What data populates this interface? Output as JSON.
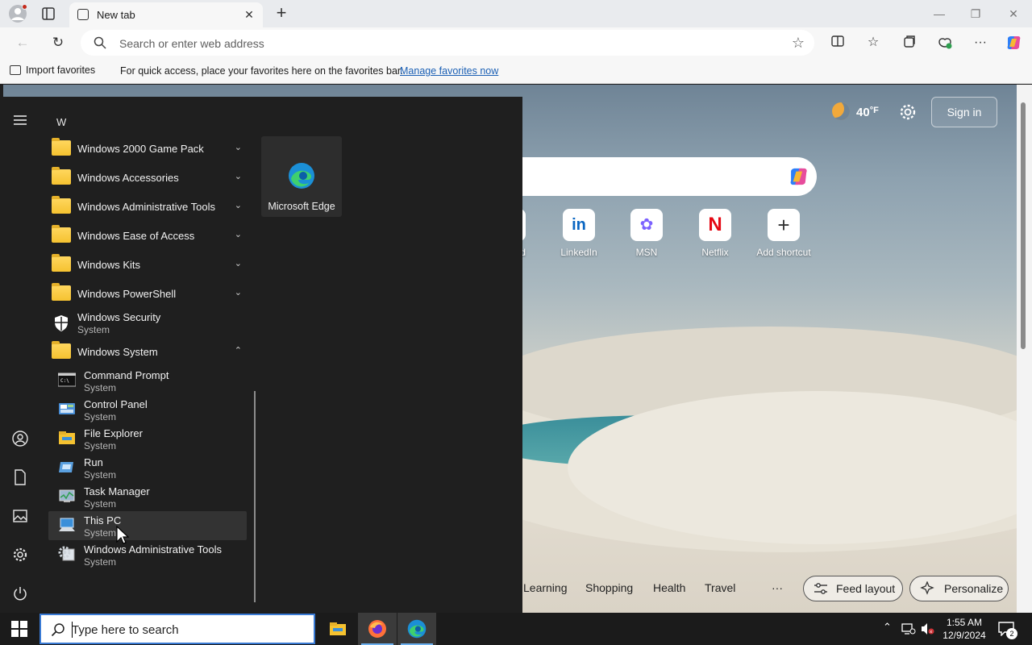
{
  "browser": {
    "tab_title": "New tab",
    "tab_close": "✕",
    "new_tab": "+",
    "address_placeholder": "Search or enter web address",
    "favorites_bar": {
      "import_label": "Import favorites",
      "message": "For quick access, place your favorites here on the favorites bar.",
      "manage_link": "Manage favorites now"
    },
    "window_controls": {
      "minimize": "—",
      "restore": "❐",
      "close": "✕"
    },
    "toolbar_icons": [
      "split-screen-icon",
      "favorites-icon",
      "collections-icon",
      "browser-essentials-icon",
      "more-icon",
      "copilot-icon"
    ]
  },
  "newtab_page": {
    "weather": {
      "temp": "40",
      "unit": "°F",
      "icon": "moon-icon"
    },
    "sign_in": "Sign in",
    "shortcuts": [
      {
        "label": "LinkedIn",
        "glyph": "in",
        "color": "#0a66c2"
      },
      {
        "label": "MSN",
        "glyph": "✿",
        "color": "#7b61ff"
      },
      {
        "label": "Netflix",
        "glyph": "N",
        "color": "#e50914"
      },
      {
        "label": "Add shortcut",
        "glyph": "+",
        "color": "#333333"
      }
    ],
    "partial_shortcut_label": "d",
    "bottom_nav": [
      "Learning",
      "Shopping",
      "Health",
      "Travel"
    ],
    "more": "···",
    "feed_layout": "Feed layout",
    "personalize": "Personalize"
  },
  "start_menu": {
    "section_letter": "W",
    "apps": [
      {
        "name": "Windows 2000 Game Pack",
        "type": "folder",
        "chevron": "⌄"
      },
      {
        "name": "Windows Accessories",
        "type": "folder",
        "chevron": "⌄"
      },
      {
        "name": "Windows Administrative Tools",
        "type": "folder",
        "chevron": "⌄"
      },
      {
        "name": "Windows Ease of Access",
        "type": "folder",
        "chevron": "⌄"
      },
      {
        "name": "Windows Kits",
        "type": "folder",
        "chevron": "⌄"
      },
      {
        "name": "Windows PowerShell",
        "type": "folder",
        "chevron": "⌄"
      },
      {
        "name": "Windows Security",
        "type": "app",
        "sub": "System"
      },
      {
        "name": "Windows System",
        "type": "folder",
        "chevron": "⌃"
      }
    ],
    "system_apps": [
      {
        "name": "Command Prompt",
        "sub": "System",
        "icon": "command-prompt-icon"
      },
      {
        "name": "Control Panel",
        "sub": "System",
        "icon": "control-panel-icon"
      },
      {
        "name": "File Explorer",
        "sub": "System",
        "icon": "file-explorer-icon"
      },
      {
        "name": "Run",
        "sub": "System",
        "icon": "run-icon"
      },
      {
        "name": "Task Manager",
        "sub": "System",
        "icon": "task-manager-icon"
      },
      {
        "name": "This PC",
        "sub": "System",
        "icon": "this-pc-icon"
      },
      {
        "name": "Windows Administrative Tools",
        "sub": "System",
        "icon": "admin-tools-icon"
      }
    ],
    "pinned_tile": "Microsoft Edge"
  },
  "taskbar": {
    "search_placeholder": "Type here to search",
    "time": "1:55 AM",
    "date": "12/9/2024",
    "notification_count": "2",
    "pinned": [
      "file-explorer-icon",
      "firefox-icon",
      "edge-icon"
    ]
  }
}
